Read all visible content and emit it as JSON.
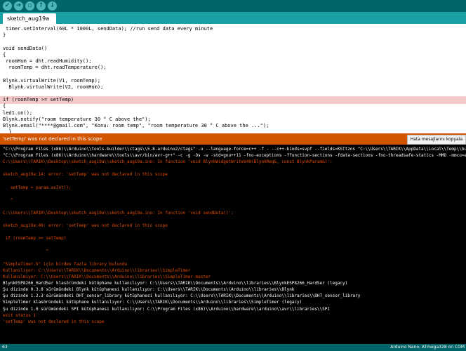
{
  "toolbar": {
    "buttons": [
      {
        "name": "verify-button",
        "icon": "check-icon",
        "glyph": "✔"
      },
      {
        "name": "upload-button",
        "icon": "arrow-right-icon",
        "glyph": "➜"
      },
      {
        "name": "new-button",
        "icon": "new-file-icon",
        "glyph": "▫"
      },
      {
        "name": "open-button",
        "icon": "arrow-up-icon",
        "glyph": "↑"
      },
      {
        "name": "save-button",
        "icon": "arrow-down-icon",
        "glyph": "↓"
      }
    ]
  },
  "tab": {
    "label": "sketch_aug19a"
  },
  "editor": {
    "lines": [
      " timer.setInterval(60L * 1000L, sendData); //run send data every minute",
      "}",
      "",
      "void sendData()",
      "{",
      " roomHum = dht.readHumidity();",
      "  roomTemp = dht.readTemperature();",
      "",
      "Blynk.virtualWrite(V1, roomTemp);",
      "  Blynk.virtualWrite(V2, roomHum);",
      "",
      "if (roomTemp >= setTemp)",
      "{",
      "led1.on();",
      "Blynk.notify(\"room temperature 30 ° C above the\");",
      "Blynk.email(\"****@gmail.com\", \"Konu: room temp\", \"room temperature 30 ° C above the ...\");",
      "  }"
    ]
  },
  "status": {
    "message": "'setTemp' was not declared in this scope",
    "copy_button": "Hata mesajlarını kopyala"
  },
  "console": {
    "lines": [
      {
        "text": "\"C:\\\\Program Files (x86)\\\\Arduino\\\\tools-builder\\\\ctags\\\\5.8-arduino2/ctags\" -u --language-force=c++ -f - --c++-kinds=svpf --fields=KSTtzns \"C:\\\\Users\\\\TARIK\\\\AppData\\\\Local\\\\Temp\\\\build6b",
        "color": "white"
      },
      {
        "text": "\"C:\\\\Program Files (x86)\\\\Arduino\\\\hardware\\\\tools\\\\avr/bin/avr-g++\" -c -g -Os -w -std=gnu++11 -fno-exceptions -ffunction-sections -fdata-sections -fno-threadsafe-statics -MMD -mmcu=at",
        "color": "white"
      },
      {
        "text": "C:\\\\Users\\\\TARIK\\\\Desktop\\\\sketch_aug19a\\\\sketch_aug19a.ino: In function 'void BlynkWidgetWriteV40(BlynkReq&, const BlynkParam&)':",
        "color": "red"
      },
      {
        "text": "",
        "color": "red"
      },
      {
        "text": "sketch_aug19a:14: error: 'setTemp' was not declared in this scope",
        "color": "red"
      },
      {
        "text": "",
        "color": "red"
      },
      {
        "text": "   setTemp = param.asInt();",
        "color": "red"
      },
      {
        "text": "",
        "color": "red"
      },
      {
        "text": "   ^",
        "color": "red"
      },
      {
        "text": "",
        "color": "red"
      },
      {
        "text": "C:\\\\Users\\\\TARIK\\\\Desktop\\\\sketch_aug19a\\\\sketch_aug19a.ino: In function 'void sendData()':",
        "color": "red"
      },
      {
        "text": "",
        "color": "red"
      },
      {
        "text": "sketch_aug19a:49: error: 'setTemp' was not declared in this scope",
        "color": "red"
      },
      {
        "text": "",
        "color": "red"
      },
      {
        "text": " if (roomTemp >= setTemp)",
        "color": "red"
      },
      {
        "text": "",
        "color": "red"
      },
      {
        "text": "                 ^",
        "color": "red"
      },
      {
        "text": "",
        "color": "red"
      },
      {
        "text": "\"SimpleTimer.h\" için birden fazla library bulundu",
        "color": "red"
      },
      {
        "text": "Kullanılıyor: C:\\\\Users\\\\TARIK\\\\Documents\\\\Arduino\\\\libraries\\\\SimpleTimer",
        "color": "red"
      },
      {
        "text": "Kullanılmıyor: C:\\\\Users\\\\TARIK\\\\Documents\\\\Arduino\\\\libraries\\\\SimpleTimer-master",
        "color": "red"
      },
      {
        "text": "BlynkESP8266_HardSer klasöründeki kütüphane kullanılıyor: C:\\\\Users\\\\TARIK\\\\Documents\\\\Arduino\\\\libraries\\\\BlynkESP8266_HardSer (legacy)",
        "color": "white"
      },
      {
        "text": "Şu dizinde 0.3.8 sürümündeki Blynk kütüphanesi kullanılıyor: C:\\\\Users\\\\TARIK\\\\Documents\\\\Arduino\\\\libraries\\\\Blynk",
        "color": "white"
      },
      {
        "text": "Şu dizinde 1.2.3 sürümündeki DHT_sensor_library kütüphanesi kullanılıyor: C:\\\\Users\\\\TARIK\\\\Documents\\\\Arduino\\\\libraries\\\\DHT_sensor_library",
        "color": "white"
      },
      {
        "text": "SimpleTimer klasöründeki kütüphane kullanılıyor: C:\\\\Users\\\\TARIK\\\\Documents\\\\Arduino\\\\libraries\\\\SimpleTimer (legacy)",
        "color": "white"
      },
      {
        "text": "Şu dizinde 1.0 sürümündeki SPI kütüphanesi kullanılıyor: C:\\\\Program Files (x86)\\\\Arduino\\\\hardware\\\\arduino\\\\avr\\\\libraries\\\\SPI",
        "color": "white"
      },
      {
        "text": "exit status 1",
        "color": "red"
      },
      {
        "text": "'setTemp' was not declared in this scope",
        "color": "red"
      }
    ]
  },
  "footer": {
    "line_number": "63",
    "board": "Arduino Nano, ATmega328 on COM"
  },
  "colors": {
    "toolbar": "#006468",
    "tabbar": "#17a1a5",
    "status_error": "#d35400",
    "console_red": "#e34c00"
  }
}
